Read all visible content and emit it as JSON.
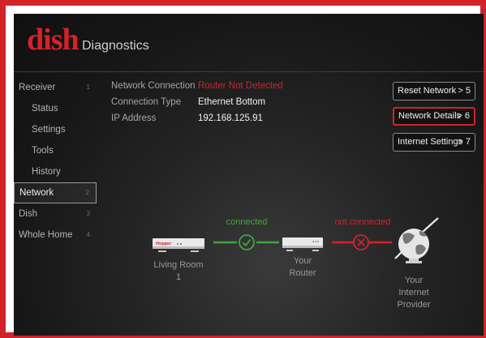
{
  "header": {
    "brand": "dish",
    "title": "Diagnostics"
  },
  "sidebar": {
    "items": [
      {
        "label": "Receiver",
        "num": "1",
        "sub": false,
        "active": false
      },
      {
        "label": "Status",
        "num": "",
        "sub": true,
        "active": false
      },
      {
        "label": "Settings",
        "num": "",
        "sub": true,
        "active": false
      },
      {
        "label": "Tools",
        "num": "",
        "sub": true,
        "active": false
      },
      {
        "label": "History",
        "num": "",
        "sub": true,
        "active": false
      },
      {
        "label": "Network",
        "num": "2",
        "sub": false,
        "active": true
      },
      {
        "label": "Dish",
        "num": "3",
        "sub": false,
        "active": false
      },
      {
        "label": "Whole Home",
        "num": "4",
        "sub": false,
        "active": false
      }
    ]
  },
  "info": {
    "network_connection_label": "Network Connection",
    "network_connection_value": "Router Not Detected",
    "connection_type_label": "Connection Type",
    "connection_type_value": "Ethernet Bottom",
    "ip_label": "IP Address",
    "ip_value": "192.168.125.91"
  },
  "actions": {
    "reset": {
      "label": "Reset Network",
      "key": "> 5"
    },
    "details": {
      "label": "Network Details",
      "key": "> 6"
    },
    "internet": {
      "label": "Internet Settings",
      "key": "> 7"
    }
  },
  "diagram": {
    "connected_label": "connected",
    "not_connected_label": "not connected",
    "receiver_brand": "Hopper",
    "living_room_line1": "Living Room",
    "living_room_line2": "1",
    "router_line1": "Your",
    "router_line2": "Router",
    "provider_line1": "Your",
    "provider_line2": "Internet",
    "provider_line3": "Provider"
  },
  "colors": {
    "accent": "#d2232a",
    "connected": "#3fa541",
    "background": "#1a1a1a"
  }
}
